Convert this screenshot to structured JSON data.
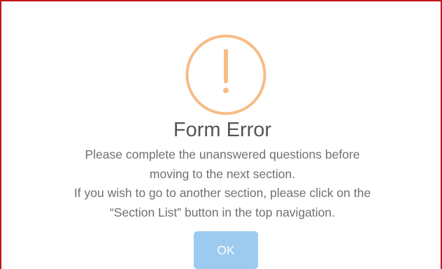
{
  "dialog": {
    "icon": "warning-exclamation-icon",
    "title": "Form Error",
    "message_lines": [
      "Please complete the unanswered questions before",
      "moving to the next section.",
      "If you wish to go to another section, please click on the",
      "“Section List” button in the top navigation."
    ],
    "ok_label": "OK"
  },
  "colors": {
    "border": "#c0161d",
    "icon": "#f8bb86",
    "button": "#9ccbef",
    "title_text": "#555555",
    "message_text": "#707070"
  }
}
